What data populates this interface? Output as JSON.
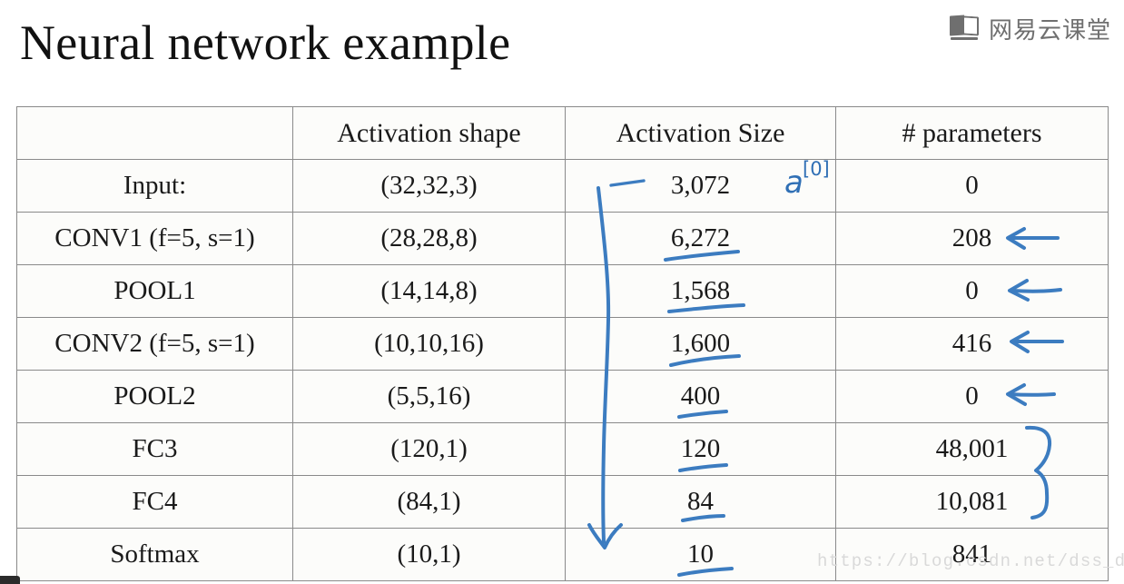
{
  "header": {
    "title": "Neural network example",
    "brand": {
      "logo_icon": "book-icon",
      "name": "网易云课堂"
    }
  },
  "table": {
    "columns": [
      "",
      "Activation shape",
      "Activation Size",
      "# parameters"
    ],
    "rows": [
      {
        "layer": "Input:",
        "shape": "(32,32,3)",
        "size": "3,072",
        "params": "0"
      },
      {
        "layer": "CONV1 (f=5, s=1)",
        "shape": "(28,28,8)",
        "size": "6,272",
        "params": "208"
      },
      {
        "layer": "POOL1",
        "shape": "(14,14,8)",
        "size": "1,568",
        "params": "0"
      },
      {
        "layer": "CONV2  (f=5, s=1)",
        "shape": "(10,10,16)",
        "size": "1,600",
        "params": "416"
      },
      {
        "layer": "POOL2",
        "shape": "(5,5,16)",
        "size": "400",
        "params": "0"
      },
      {
        "layer": "FC3",
        "shape": "(120,1)",
        "size": "120",
        "params": "48,001"
      },
      {
        "layer": "FC4",
        "shape": "(84,1)",
        "size": "84",
        "params": "10,081"
      },
      {
        "layer": "Softmax",
        "shape": "(10,1)",
        "size": "10",
        "params": "841"
      }
    ]
  },
  "annotations": {
    "ink_color": "#3c7cc0",
    "activation_label": "a",
    "activation_superscript": "[0]",
    "notes": [
      "long downward arrow spanning Activation Size column",
      "underlines beneath activation size values",
      "left-pointing arrows beside parameter counts 208, 0, 416, 0",
      "curly brace grouping 48,001 and 10,081"
    ]
  },
  "watermark": {
    "text": "https://blog.csdn.net/dss_dsssss"
  },
  "bottom_caption": {
    "text": ""
  }
}
